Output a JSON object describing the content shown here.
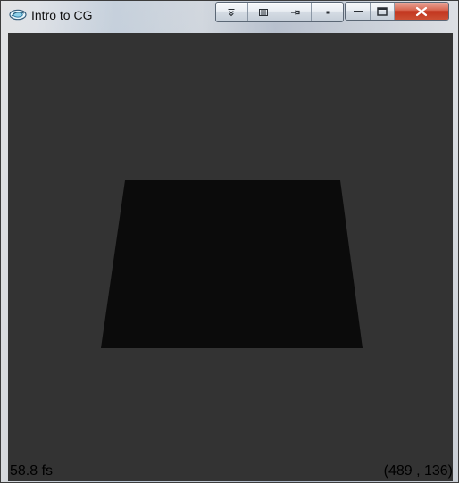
{
  "window": {
    "title": "Intro to CG"
  },
  "icons": {
    "app": "window-app-icon",
    "extra_buttons": [
      "collapse-icon",
      "grid-icon",
      "pin-icon",
      "dot-icon"
    ],
    "minimize": "minimize-icon",
    "maximize": "maximize-icon",
    "close": "close-icon"
  },
  "scene": {
    "shape": "trapezoid",
    "fill_color": "#0b0b0b",
    "background_color": "#333333"
  },
  "status": {
    "fps": "58.8 fs",
    "mouse_coords": "(489 , 136)"
  }
}
